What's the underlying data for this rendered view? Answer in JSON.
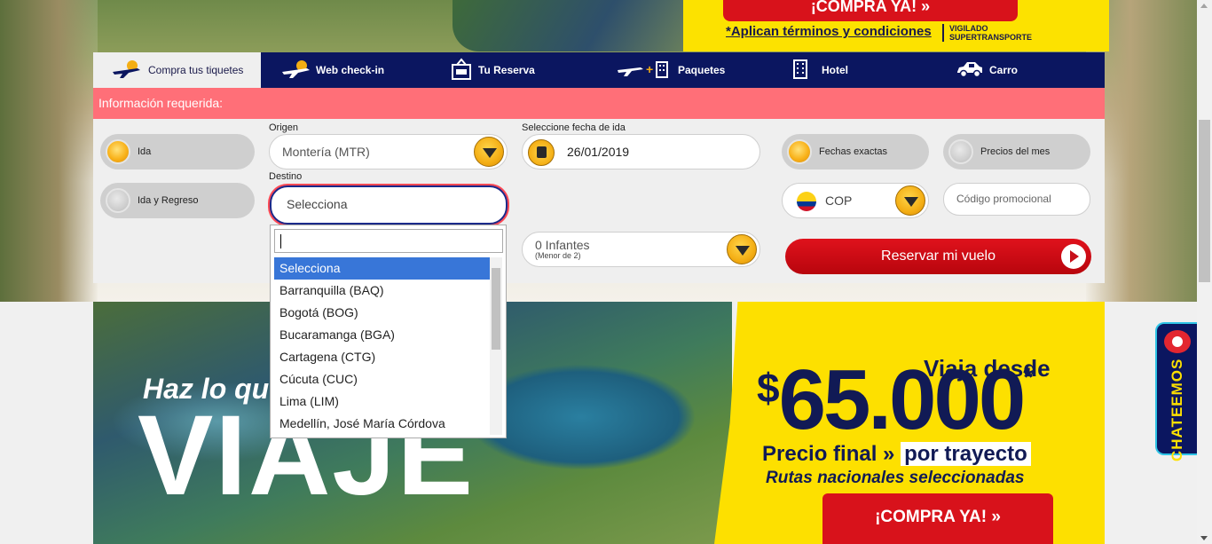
{
  "top_banner": {
    "cta_label": "¡COMPRA YA! »",
    "terms_link": "*Aplican términos y condiciones",
    "vigilado_logo_text": "VIGILADO SUPERTRANSPORTE"
  },
  "tabs": [
    {
      "label": "Compra tus tiquetes",
      "icon": "plane-icon",
      "active": true
    },
    {
      "label": "Web check-in",
      "icon": "plane-checkin-icon",
      "active": false
    },
    {
      "label": "Tu Reserva",
      "icon": "reservation-icon",
      "active": false
    },
    {
      "label": "Paquetes",
      "icon": "plane-hotel-icon",
      "active": false
    },
    {
      "label": "Hotel",
      "icon": "building-icon",
      "active": false
    },
    {
      "label": "Carro",
      "icon": "car-icon",
      "active": false
    }
  ],
  "form": {
    "required_info": "Información requerida:",
    "trip_type": {
      "one_way": "Ida",
      "round_trip": "Ida y Regreso"
    },
    "origin_label": "Origen",
    "origin_value": "Montería (MTR)",
    "destination_label": "Destino",
    "destination_value": "Selecciona",
    "date_label": "Seleccione fecha de ida",
    "date_value": "26/01/2019",
    "infants_value": "0 Infantes",
    "infants_note": "(Menor de 2)",
    "exact_dates": "Fechas exactas",
    "month_prices": "Precios del mes",
    "currency": "COP",
    "promo_placeholder": "Código promocional",
    "submit_label": "Reservar mi vuelo"
  },
  "destination_dropdown": {
    "search_value": "",
    "options": [
      "Selecciona",
      "Barranquilla (BAQ)",
      "Bogotá (BOG)",
      "Bucaramanga (BGA)",
      "Cartagena (CTG)",
      "Cúcuta (CUC)",
      "Lima (LIM)",
      "Medellín, José María Córdova"
    ],
    "selected": "Selecciona"
  },
  "promo": {
    "haz": "Haz lo que",
    "viaje": "VIAJE",
    "viaja_desde": "Viaja desde",
    "price_symbol": "$",
    "price_value": "65.000",
    "price_asterisk": "*",
    "precio_final": "Precio final »",
    "por_trayecto": "por trayecto",
    "rutas": "Rutas nacionales seleccionadas",
    "cta": "¡COMPRA YA! »"
  },
  "chat": {
    "label": "CHATEEMOS"
  },
  "colors": {
    "navy": "#0b1660",
    "alert_bar": "#ff6f78",
    "accent_red": "#d8121b",
    "accent_yellow": "#fde000",
    "select_blue": "#3876d8"
  }
}
